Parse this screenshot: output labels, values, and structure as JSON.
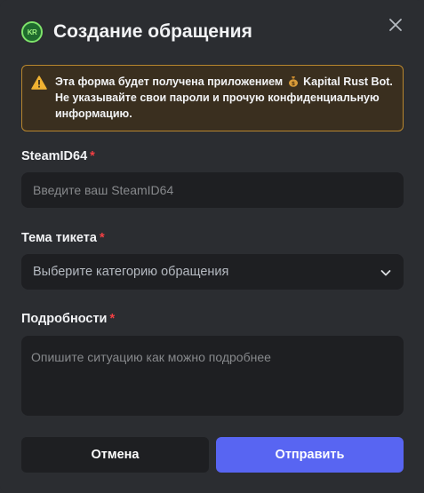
{
  "modal": {
    "app_icon_text": "KR",
    "title": "Создание обращения",
    "close_icon": "close-icon"
  },
  "warning": {
    "icon": "warning-triangle-icon",
    "line1_prefix": "Эта форма будет получена приложением",
    "bot_icon": "money-bag-icon",
    "bot_name": "Kapital Rust Bot",
    "line1_suffix": ".",
    "line2": "Не указывайте свои пароли и прочую конфиденциальную информацию.",
    "accent_color": "#b7862e"
  },
  "fields": {
    "steamid": {
      "label": "SteamID64",
      "required_mark": "*",
      "value": "",
      "placeholder": "Введите ваш SteamID64"
    },
    "topic": {
      "label": "Тема тикета",
      "required_mark": "*",
      "selected": "Выберите категорию обращения",
      "icon": "chevron-down-icon"
    },
    "details": {
      "label": "Подробности",
      "required_mark": "*",
      "value": "",
      "placeholder": "Опишите ситуацию как можно подробнее"
    }
  },
  "actions": {
    "cancel_label": "Отмена",
    "submit_label": "Отправить",
    "submit_color": "#5865f2"
  }
}
